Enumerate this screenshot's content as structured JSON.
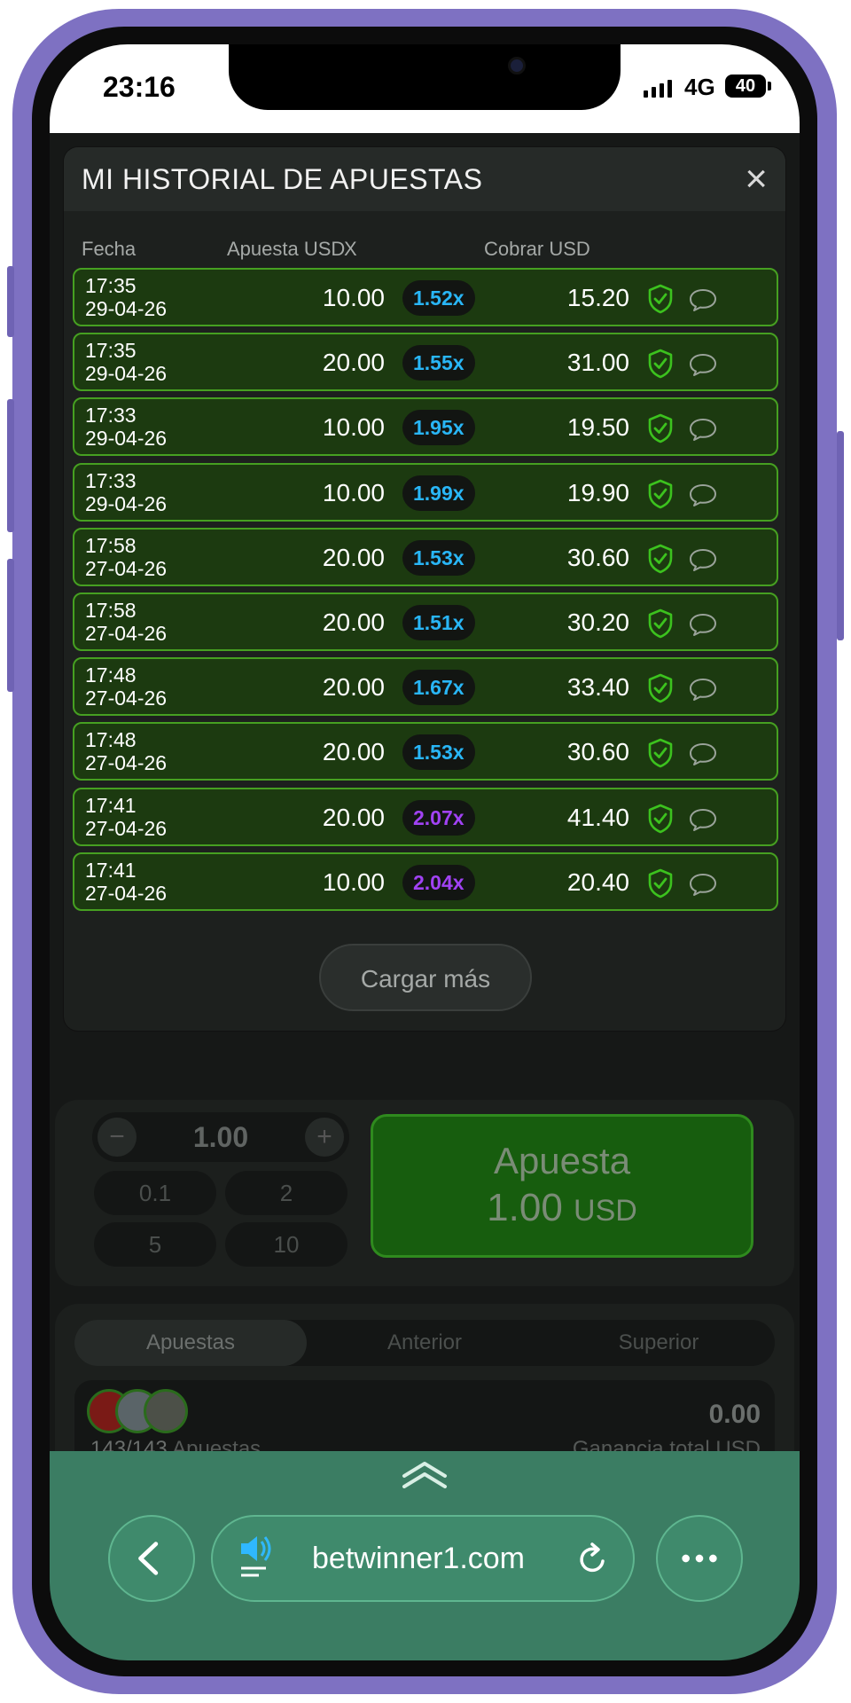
{
  "status_bar": {
    "time": "23:16",
    "network": "4G",
    "battery": "40"
  },
  "modal": {
    "title": "MI HISTORIAL DE APUESTAS",
    "close_glyph": "×",
    "columns": {
      "date": "Fecha",
      "stake": "Apuesta USD",
      "multiplier": "X",
      "cashout": "Cobrar USD"
    },
    "rows": [
      {
        "time": "17:35",
        "date": "29-04-26",
        "stake": "10.00",
        "multiplier": "1.52x",
        "mult_color": "#29b6f6",
        "cashout": "15.20"
      },
      {
        "time": "17:35",
        "date": "29-04-26",
        "stake": "20.00",
        "multiplier": "1.55x",
        "mult_color": "#29b6f6",
        "cashout": "31.00"
      },
      {
        "time": "17:33",
        "date": "29-04-26",
        "stake": "10.00",
        "multiplier": "1.95x",
        "mult_color": "#29b6f6",
        "cashout": "19.50"
      },
      {
        "time": "17:33",
        "date": "29-04-26",
        "stake": "10.00",
        "multiplier": "1.99x",
        "mult_color": "#29b6f6",
        "cashout": "19.90"
      },
      {
        "time": "17:58",
        "date": "27-04-26",
        "stake": "20.00",
        "multiplier": "1.53x",
        "mult_color": "#29b6f6",
        "cashout": "30.60"
      },
      {
        "time": "17:58",
        "date": "27-04-26",
        "stake": "20.00",
        "multiplier": "1.51x",
        "mult_color": "#29b6f6",
        "cashout": "30.20"
      },
      {
        "time": "17:48",
        "date": "27-04-26",
        "stake": "20.00",
        "multiplier": "1.67x",
        "mult_color": "#29b6f6",
        "cashout": "33.40"
      },
      {
        "time": "17:48",
        "date": "27-04-26",
        "stake": "20.00",
        "multiplier": "1.53x",
        "mult_color": "#29b6f6",
        "cashout": "30.60"
      },
      {
        "time": "17:41",
        "date": "27-04-26",
        "stake": "20.00",
        "multiplier": "2.07x",
        "mult_color": "#a142f4",
        "cashout": "41.40"
      },
      {
        "time": "17:41",
        "date": "27-04-26",
        "stake": "10.00",
        "multiplier": "2.04x",
        "mult_color": "#a142f4",
        "cashout": "20.40"
      }
    ],
    "load_more": "Cargar más"
  },
  "stake": {
    "minus": "−",
    "plus": "+",
    "value": "1.00",
    "quick": [
      "0.1",
      "2",
      "5",
      "10"
    ],
    "bet_label": "Apuesta",
    "bet_amount": "1.00",
    "bet_currency": "USD"
  },
  "tabs": {
    "bets": "Apuestas",
    "previous": "Anterior",
    "top": "Superior"
  },
  "stats": {
    "count": "143/143",
    "count_label": "Apuestas",
    "total": "0.00",
    "total_label": "Ganancia total USD"
  },
  "browser": {
    "url": "betwinner1.com"
  },
  "colors": {
    "row_bg": "#1c3a10",
    "row_border": "#46a021",
    "bet_button": "#175d0e",
    "browser_bar": "#3b7d63"
  },
  "icons": [
    "back-icon",
    "speaker-icon",
    "reload-icon",
    "more-icon",
    "shield-check-icon",
    "chat-bubble-icon",
    "close-icon",
    "chevron-up-icon"
  ]
}
